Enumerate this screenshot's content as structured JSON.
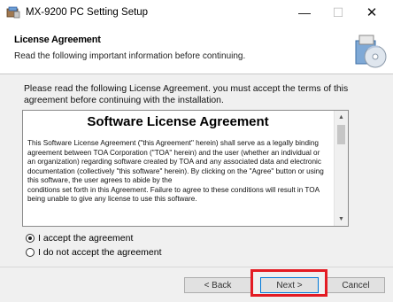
{
  "window": {
    "title": "MX-9200 PC Setting Setup",
    "minimize_glyph": "—",
    "maximize_glyph": "☐",
    "close_glyph": "✕"
  },
  "header": {
    "title": "License Agreement",
    "subtitle": "Read the following important information before continuing."
  },
  "intro": {
    "text": "Please read the following License Agreement. you must accept the terms of this agreement before continuing with the installation."
  },
  "license": {
    "heading": "Software License Agreement",
    "paragraph1": "This Software License Agreement (\"this Agreement\" herein) shall serve as a legally binding agreement between TOA Corporation (\"TOA\" herein) and the user (whether an individual or an organization) regarding software created by TOA and any associated data and electronic documentation (collectively \"this software\" herein). By clicking on the \"Agree\" button or using this software, the user agrees to abide by the",
    "paragraph2": "conditions set forth in this Agreement. Failure to agree to these conditions will result in TOA being unable to give any license to use this software."
  },
  "options": {
    "accept_label": "I accept the agreement",
    "decline_label": "I do not accept the agreement",
    "selected": "accept"
  },
  "buttons": {
    "back": "< Back",
    "next": "Next >",
    "cancel": "Cancel"
  },
  "colors": {
    "highlight": "#e31b23",
    "focus": "#0078d7"
  },
  "icons": {
    "app": "installer-icon",
    "header_graphic": "setup-disc-icon"
  }
}
